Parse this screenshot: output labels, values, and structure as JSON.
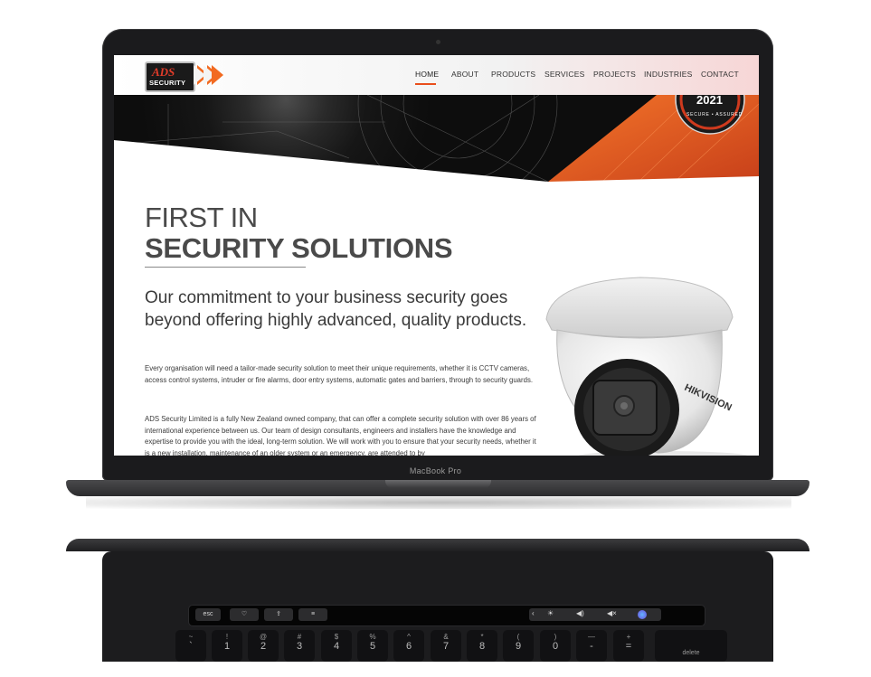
{
  "device": {
    "model_label": "MacBook Pro"
  },
  "site": {
    "logo": {
      "brand": "ADS",
      "tagline": "SECURITY"
    },
    "nav": [
      "HOME",
      "ABOUT",
      "PRODUCTS",
      "SERVICES",
      "PROJECTS",
      "INDUSTRIES",
      "CONTACT"
    ],
    "active_nav": "HOME",
    "badge": {
      "year": "2021",
      "subtitle": "SECURE • ASSURED"
    },
    "heading_line1": "FIRST IN",
    "heading_line2": "SECURITY SOLUTIONS",
    "lead": "Our commitment to your business security goes beyond offering highly advanced, quality products.",
    "paragraph1": "Every organisation will need a tailor-made security solution to meet their unique requirements, whether it is CCTV cameras, access control systems, intruder or fire alarms, door entry systems, automatic gates and barriers, through to security guards.",
    "paragraph2": "ADS Security Limited is a fully New Zealand owned company, that can offer a complete security solution with over 86 years of international experience between us. Our team of design consultants, engineers and installers have the knowledge and expertise to provide you with the ideal, long-term solution. We will work with you to ensure that your security needs, whether it is a new installation, maintenance of an older system or an emergency, are attended to by",
    "camera_brand": "HIKVISION",
    "colors": {
      "accent": "#f26a21",
      "underline": "#e94e1b",
      "text": "#4a4a4a"
    }
  },
  "touchbar": {
    "esc": "esc",
    "icons": [
      "heart-icon",
      "share-icon",
      "sliders-icon"
    ],
    "control_strip": [
      "‹",
      "☀",
      "🔊",
      "🔇",
      "siri"
    ]
  },
  "keyboard": {
    "number_row": [
      {
        "top": "~",
        "bottom": "`"
      },
      {
        "top": "!",
        "bottom": "1"
      },
      {
        "top": "@",
        "bottom": "2"
      },
      {
        "top": "#",
        "bottom": "3"
      },
      {
        "top": "$",
        "bottom": "4"
      },
      {
        "top": "%",
        "bottom": "5"
      },
      {
        "top": "^",
        "bottom": "6"
      },
      {
        "top": "&",
        "bottom": "7"
      },
      {
        "top": "*",
        "bottom": "8"
      },
      {
        "top": "(",
        "bottom": "9"
      },
      {
        "top": ")",
        "bottom": "0"
      },
      {
        "top": "—",
        "bottom": "-"
      },
      {
        "top": "+",
        "bottom": "="
      }
    ],
    "delete_label": "delete"
  }
}
